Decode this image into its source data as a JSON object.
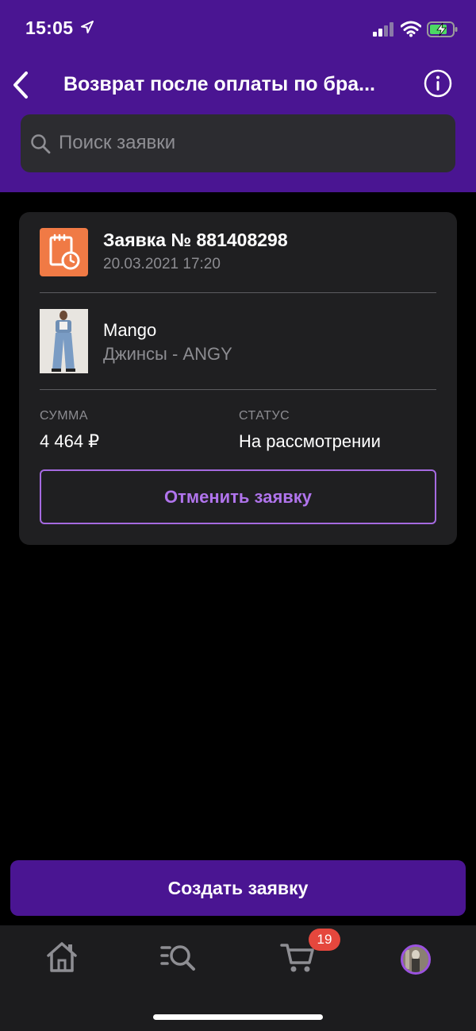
{
  "status_bar": {
    "time": "15:05"
  },
  "nav": {
    "title": "Возврат после оплаты по бра..."
  },
  "search": {
    "placeholder": "Поиск заявки"
  },
  "request": {
    "title": "Заявка № 881408298",
    "date": "20.03.2021 17:20",
    "brand": "Mango",
    "product": "Джинсы - ANGY",
    "sum_label": "СУММА",
    "sum_value": "4 464 ₽",
    "status_label": "СТАТУС",
    "status_value": "На рассмотрении",
    "cancel_label": "Отменить заявку"
  },
  "create_button": {
    "label": "Создать заявку"
  },
  "tabbar": {
    "items": [
      {
        "name": "home",
        "icon": "home-icon"
      },
      {
        "name": "catalog-search",
        "icon": "catalog-search-icon"
      },
      {
        "name": "cart",
        "icon": "cart-icon"
      },
      {
        "name": "profile",
        "icon": "avatar"
      }
    ],
    "cart_badge": "19"
  },
  "colors": {
    "brand_purple": "#4a1592",
    "accent_purple": "#b074ec",
    "request_icon_orange": "#f07a45",
    "badge_red": "#e5473d"
  }
}
